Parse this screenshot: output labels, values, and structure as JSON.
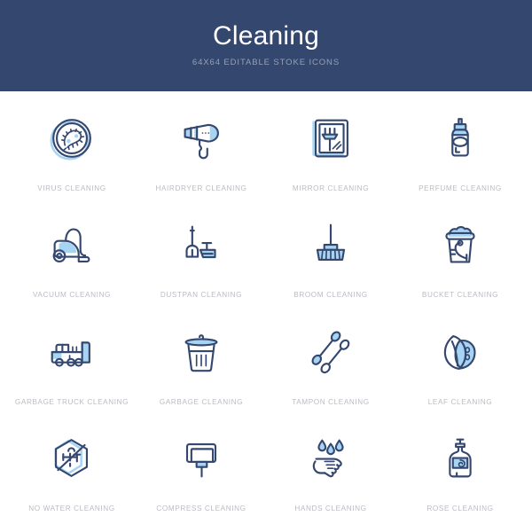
{
  "header": {
    "title": "Cleaning",
    "subtitle": "64X64 editable stoke icons",
    "background_color": "#34476f",
    "title_color": "#ffffff",
    "subtitle_color": "#96a0b8"
  },
  "palette": {
    "stroke_dark": "#34476f",
    "fill_light": "#a6d4f2",
    "label_color": "#b9bcc4",
    "page_background": "#ffffff"
  },
  "grid": {
    "columns": 4,
    "rows": 4,
    "items": [
      {
        "label": "virus cleaning",
        "icon": "virus-icon"
      },
      {
        "label": "hairdryer cleaning",
        "icon": "hairdryer-icon"
      },
      {
        "label": "mirror cleaning",
        "icon": "mirror-icon"
      },
      {
        "label": "perfume cleaning",
        "icon": "perfume-icon"
      },
      {
        "label": "vacuum cleaning",
        "icon": "vacuum-icon"
      },
      {
        "label": "dustpan cleaning",
        "icon": "dustpan-icon"
      },
      {
        "label": "broom cleaning",
        "icon": "broom-icon"
      },
      {
        "label": "bucket cleaning",
        "icon": "bucket-icon"
      },
      {
        "label": "garbage truck cleaning",
        "icon": "garbage-truck-icon"
      },
      {
        "label": "garbage cleaning",
        "icon": "garbage-bin-icon"
      },
      {
        "label": "tampon cleaning",
        "icon": "tampon-icon"
      },
      {
        "label": "leaf cleaning",
        "icon": "leaf-icon"
      },
      {
        "label": "no water cleaning",
        "icon": "no-water-icon"
      },
      {
        "label": "compress cleaning",
        "icon": "compress-icon"
      },
      {
        "label": "hands cleaning",
        "icon": "hands-icon"
      },
      {
        "label": "rose cleaning",
        "icon": "rose-soap-icon"
      }
    ]
  }
}
